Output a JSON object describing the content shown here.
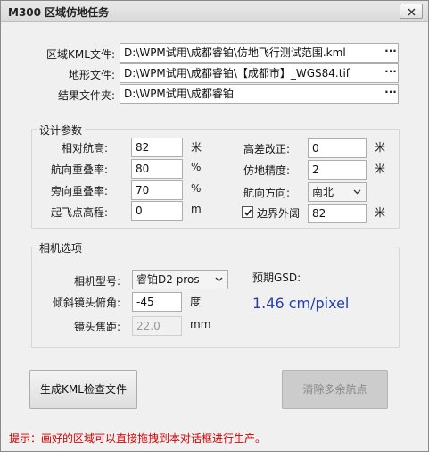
{
  "window": {
    "title": "M300 区域仿地任务"
  },
  "files": {
    "kml_label": "区域KML文件:",
    "kml_value": "D:\\WPM试用\\成都睿铂\\仿地飞行测试范围.kml",
    "terrain_label": "地形文件:",
    "terrain_value": "D:\\WPM试用\\成都睿铂\\【成都市】_WGS84.tif",
    "result_label": "结果文件夹:",
    "result_value": "D:\\WPM试用\\成都睿铂",
    "browse_label": "···"
  },
  "design": {
    "group_title": "设计参数",
    "rel_height_label": "相对航高:",
    "rel_height_value": "82",
    "rel_height_unit": "米",
    "forward_overlap_label": "航向重叠率:",
    "forward_overlap_value": "80",
    "forward_overlap_unit": "%",
    "side_overlap_label": "旁向重叠率:",
    "side_overlap_value": "70",
    "side_overlap_unit": "%",
    "takeoff_elev_label": "起飞点高程:",
    "takeoff_elev_value": "0",
    "takeoff_elev_unit": "m",
    "height_diff_label": "高差改正:",
    "height_diff_value": "0",
    "height_diff_unit": "米",
    "terrain_precision_label": "仿地精度:",
    "terrain_precision_value": "2",
    "terrain_precision_unit": "米",
    "heading_label": "航向方向:",
    "heading_value": "南北",
    "boundary_label": "边界外阔",
    "boundary_checked": true,
    "boundary_value": "82",
    "boundary_unit": "米"
  },
  "camera": {
    "group_title": "相机选项",
    "model_label": "相机型号:",
    "model_value": "睿铂D2 pros",
    "tilt_label": "倾斜镜头俯角:",
    "tilt_value": "-45",
    "tilt_unit": "度",
    "focal_label": "镜头焦距:",
    "focal_value": "22.0",
    "focal_unit": "mm",
    "gsd_label": "预期GSD:",
    "gsd_value": "1.46 cm/pixel"
  },
  "actions": {
    "generate_label": "生成KML检查文件",
    "clear_label": "清除多余航点"
  },
  "hint": "提示：画好的区域可以直接拖拽到本对话框进行生产。",
  "colors": {
    "gsd": "#1f3fb4",
    "hint": "#d40000"
  }
}
